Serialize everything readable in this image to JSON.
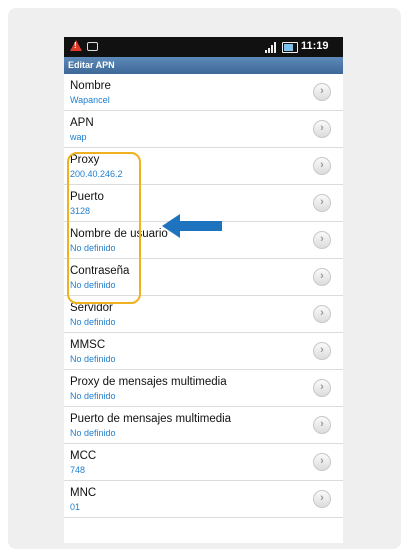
{
  "status": {
    "time": "11:19"
  },
  "title": "Editar APN",
  "rows": [
    {
      "label": "Nombre",
      "value": "Wapancel"
    },
    {
      "label": "APN",
      "value": "wap"
    },
    {
      "label": "Proxy",
      "value": "200.40.246.2"
    },
    {
      "label": "Puerto",
      "value": "3128"
    },
    {
      "label": "Nombre de usuario",
      "value": "No definido"
    },
    {
      "label": "Contraseña",
      "value": "No definido"
    },
    {
      "label": "Servidor",
      "value": "No definido"
    },
    {
      "label": "MMSC",
      "value": "No definido"
    },
    {
      "label": "Proxy de mensajes multimedia",
      "value": "No definido"
    },
    {
      "label": "Puerto de mensajes multimedia",
      "value": "No definido"
    },
    {
      "label": "MCC",
      "value": "748"
    },
    {
      "label": "MNC",
      "value": "01"
    }
  ],
  "colors": {
    "highlight": "#f0b21c",
    "arrow": "#1e73be",
    "value_text": "#1f7fd0"
  }
}
